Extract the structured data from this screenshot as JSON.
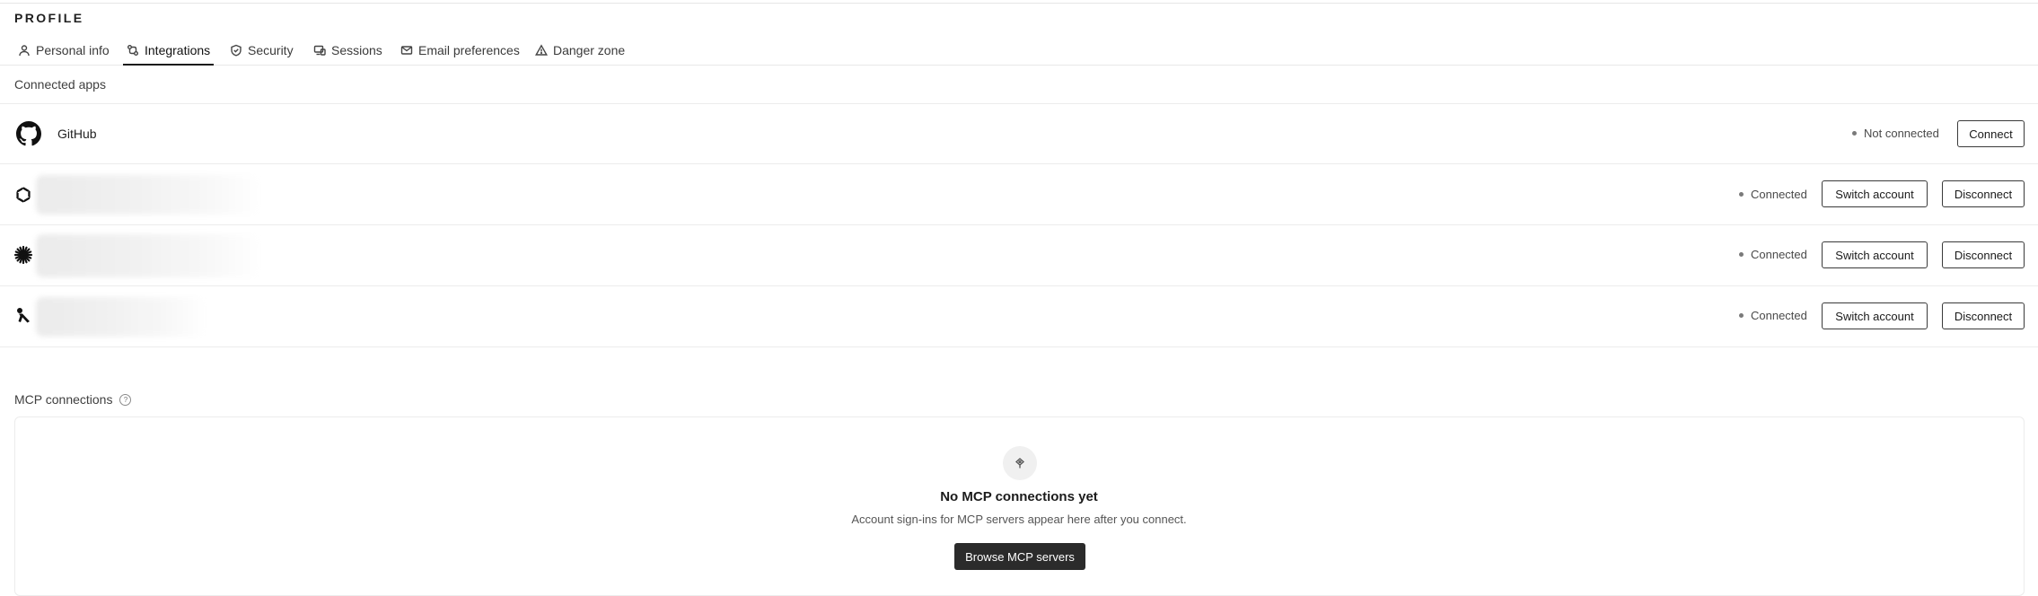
{
  "page": {
    "title": "PROFILE"
  },
  "tabs": [
    {
      "label": "Personal info",
      "icon": "user-icon"
    },
    {
      "label": "Integrations",
      "icon": "integrations-icon",
      "active": true
    },
    {
      "label": "Security",
      "icon": "shield-icon"
    },
    {
      "label": "Sessions",
      "icon": "sessions-icon"
    },
    {
      "label": "Email preferences",
      "icon": "mail-icon"
    },
    {
      "label": "Danger zone",
      "icon": "warning-icon"
    }
  ],
  "connected_apps": {
    "label": "Connected apps",
    "apps": [
      {
        "name": "GitHub",
        "icon": "github-icon",
        "status": "Not connected",
        "primary_action": "Connect"
      },
      {
        "name": "",
        "icon": "openai-icon",
        "status": "Connected",
        "switch_label": "Switch account",
        "disconnect_label": "Disconnect"
      },
      {
        "name": "",
        "icon": "asterisk-icon",
        "status": "Connected",
        "switch_label": "Switch account",
        "disconnect_label": "Disconnect"
      },
      {
        "name": "",
        "icon": "figure-icon",
        "status": "Connected",
        "switch_label": "Switch account",
        "disconnect_label": "Disconnect"
      }
    ]
  },
  "mcp": {
    "label": "MCP connections",
    "empty_title": "No MCP connections yet",
    "empty_subtitle": "Account sign-ins for MCP servers appear here after you connect.",
    "browse_label": "Browse MCP servers"
  }
}
